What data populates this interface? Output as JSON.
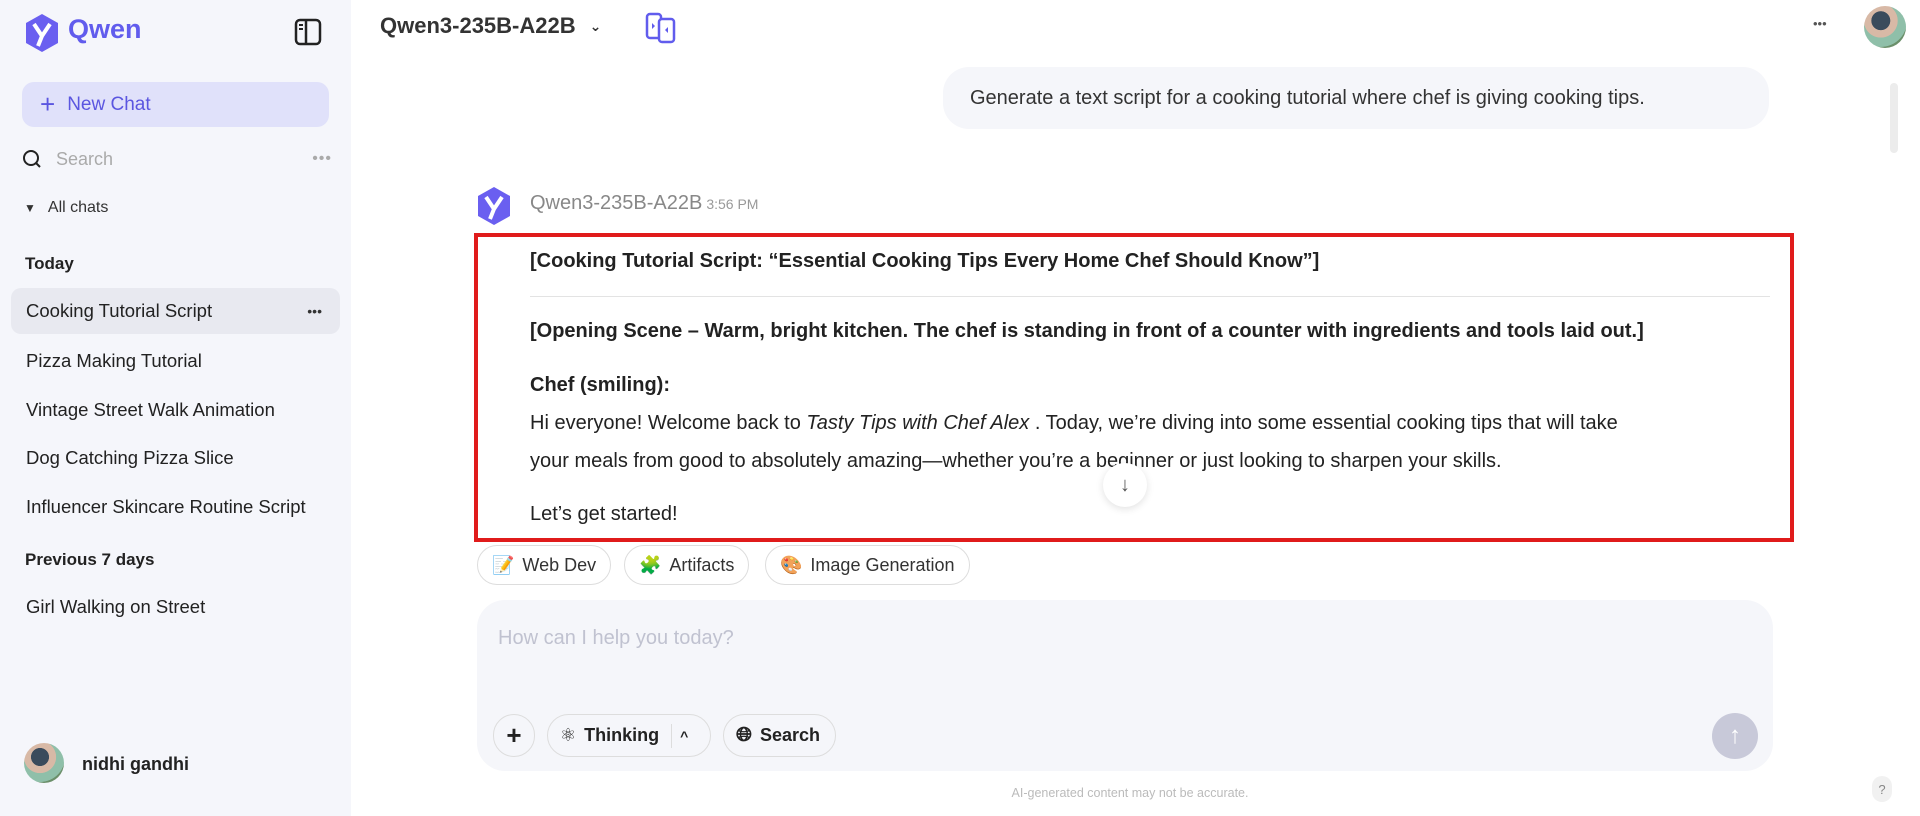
{
  "sidebar": {
    "brand": "Qwen",
    "new_chat": "New Chat",
    "search_placeholder": "Search",
    "all_chats": "All chats",
    "sections": [
      {
        "label": "Today",
        "items": [
          "Cooking Tutorial Script",
          "Pizza Making Tutorial",
          "Vintage Street Walk Animation",
          "Dog Catching Pizza Slice",
          "Influencer Skincare Routine Script"
        ]
      },
      {
        "label": "Previous 7 days",
        "items": [
          "Girl Walking on Street"
        ]
      }
    ],
    "user_name": "nidhi gandhi"
  },
  "header": {
    "model": "Qwen3-235B-A22B"
  },
  "conversation": {
    "user_message": "Generate a text script for a cooking tutorial where chef is giving cooking tips.",
    "assistant_name": "Qwen3-235B-A22B",
    "assistant_time": "3:56 PM",
    "title": "[Cooking Tutorial Script: “Essential Cooking Tips Every Home Chef Should Know”]",
    "scene": "[Opening Scene – Warm, bright kitchen. The chef is standing in front of a counter with ingredients and tools laid out.]",
    "speaker": "Chef (smiling):",
    "para_a": "Hi everyone! Welcome back to ",
    "para_show": "Tasty Tips with Chef Alex",
    "para_b": " . Today, we’re diving into some essential cooking tips that will take",
    "para_line2": "your meals from good to absolutely amazing—whether you’re a beginner or just looking to sharpen your skills.",
    "closing": "Let’s get started!"
  },
  "chips": [
    "Web Dev",
    "Artifacts",
    "Image Generation"
  ],
  "composer": {
    "placeholder": "How can I help you today?",
    "thinking": "Thinking",
    "search": "Search"
  },
  "footer": "AI-generated content may not be accurate.",
  "help": "?",
  "colors": {
    "accent": "#615ced",
    "highlight_box": "#e01b1b"
  }
}
